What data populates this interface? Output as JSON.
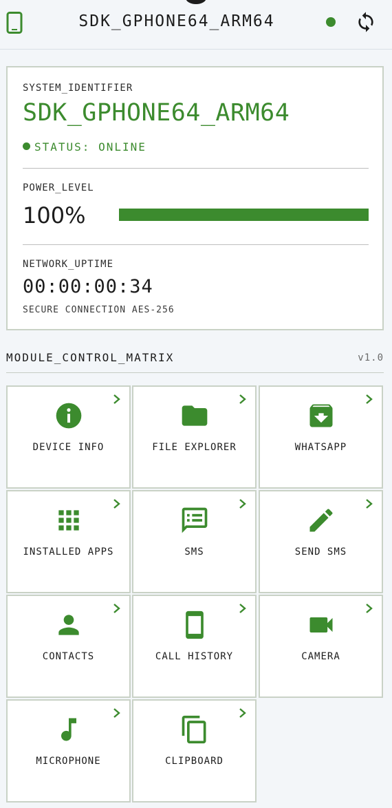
{
  "topbar": {
    "title": "SDK_GPHONE64_ARM64",
    "left_icon": "phone-icon",
    "right_icon": "sync-icon",
    "status_color": "#3c8b2e"
  },
  "system": {
    "identifier_label": "SYSTEM_IDENTIFIER",
    "device_name": "SDK_GPHONE64_ARM64",
    "status_text": "STATUS: ONLINE",
    "power_label": "POWER_LEVEL",
    "power_value": "100%",
    "power_level": 1.0,
    "uptime_label": "NETWORK_UPTIME",
    "uptime_value": "00:00:00:34",
    "secure_text": "SECURE CONNECTION AES-256"
  },
  "matrix": {
    "title": "MODULE_CONTROL_MATRIX",
    "version": "v1.0",
    "modules": [
      {
        "label": "DEVICE INFO",
        "icon": "info-icon"
      },
      {
        "label": "FILE EXPLORER",
        "icon": "folder-icon"
      },
      {
        "label": "WHATSAPP",
        "icon": "archive-icon"
      },
      {
        "label": "INSTALLED APPS",
        "icon": "apps-grid-icon"
      },
      {
        "label": "SMS",
        "icon": "message-icon"
      },
      {
        "label": "SEND SMS",
        "icon": "pencil-icon"
      },
      {
        "label": "CONTACTS",
        "icon": "person-icon"
      },
      {
        "label": "CALL HISTORY",
        "icon": "phone-icon"
      },
      {
        "label": "CAMERA",
        "icon": "videocam-icon"
      },
      {
        "label": "MICROPHONE",
        "icon": "music-note-icon"
      },
      {
        "label": "CLIPBOARD",
        "icon": "copy-icon"
      }
    ]
  },
  "colors": {
    "accent": "#3c8b2e",
    "card_border": "#c9d2c6",
    "background": "#f3f6f9"
  }
}
